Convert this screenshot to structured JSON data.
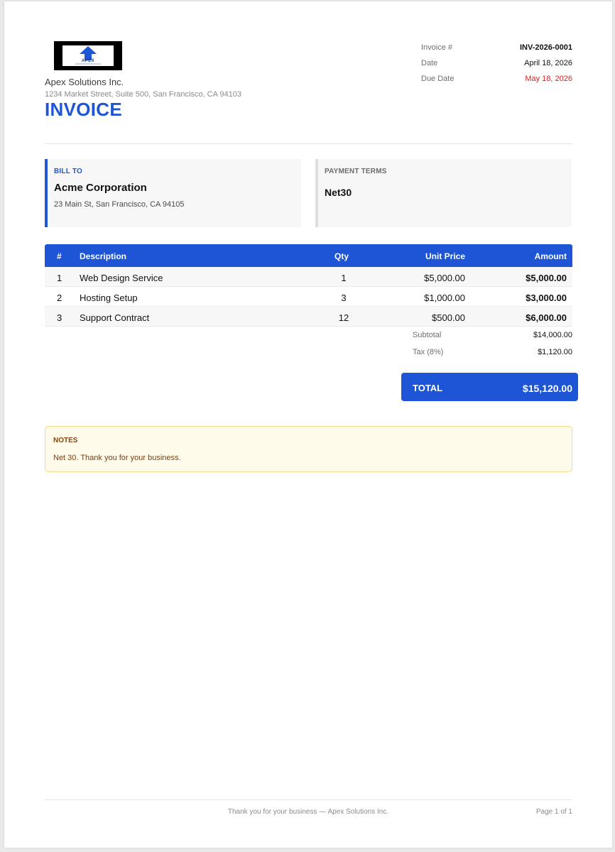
{
  "company": {
    "logo_text": "APEX",
    "name": "Apex Solutions Inc.",
    "address": "1234 Market Street, Suite 500, San Francisco, CA 94103"
  },
  "document": {
    "title": "INVOICE"
  },
  "meta": [
    {
      "label": "Invoice #",
      "value": "INV-2026-0001"
    },
    {
      "label": "Date",
      "value": "April 18, 2026"
    },
    {
      "label": "Due Date",
      "value": "May 18, 2026"
    }
  ],
  "bill_to": {
    "label": "BILL TO",
    "name": "Acme Corporation",
    "address": "23 Main St, San Francisco, CA 94105"
  },
  "payment_terms": {
    "label": "PAYMENT TERMS",
    "value": "Net30"
  },
  "table": {
    "headers": {
      "num": "#",
      "description": "Description",
      "qty": "Qty",
      "unit_price": "Unit Price",
      "amount": "Amount"
    },
    "rows": [
      {
        "num": "1",
        "description": "Web Design Service",
        "qty": "1",
        "unit_price": "$5,000.00",
        "amount": "$5,000.00"
      },
      {
        "num": "2",
        "description": "Hosting Setup",
        "qty": "3",
        "unit_price": "$1,000.00",
        "amount": "$3,000.00"
      },
      {
        "num": "3",
        "description": "Support Contract",
        "qty": "12",
        "unit_price": "$500.00",
        "amount": "$6,000.00"
      }
    ]
  },
  "summary": {
    "subtotal_label": "Subtotal",
    "subtotal_value": "$14,000.00",
    "tax_label": "Tax (8%)",
    "tax_value": "$1,120.00",
    "total_label": "TOTAL",
    "total_value": "$15,120.00"
  },
  "notes": {
    "label": "NOTES",
    "text": "Net 30. Thank you for your business."
  },
  "footer": {
    "text": "Thank you for your business — Apex Solutions Inc.",
    "page": "Page 1 of 1"
  },
  "colors": {
    "accent": "#1d55d6",
    "due_date": "#e02020",
    "notes_bg": "#fffbea",
    "notes_border": "#f6d98a"
  }
}
